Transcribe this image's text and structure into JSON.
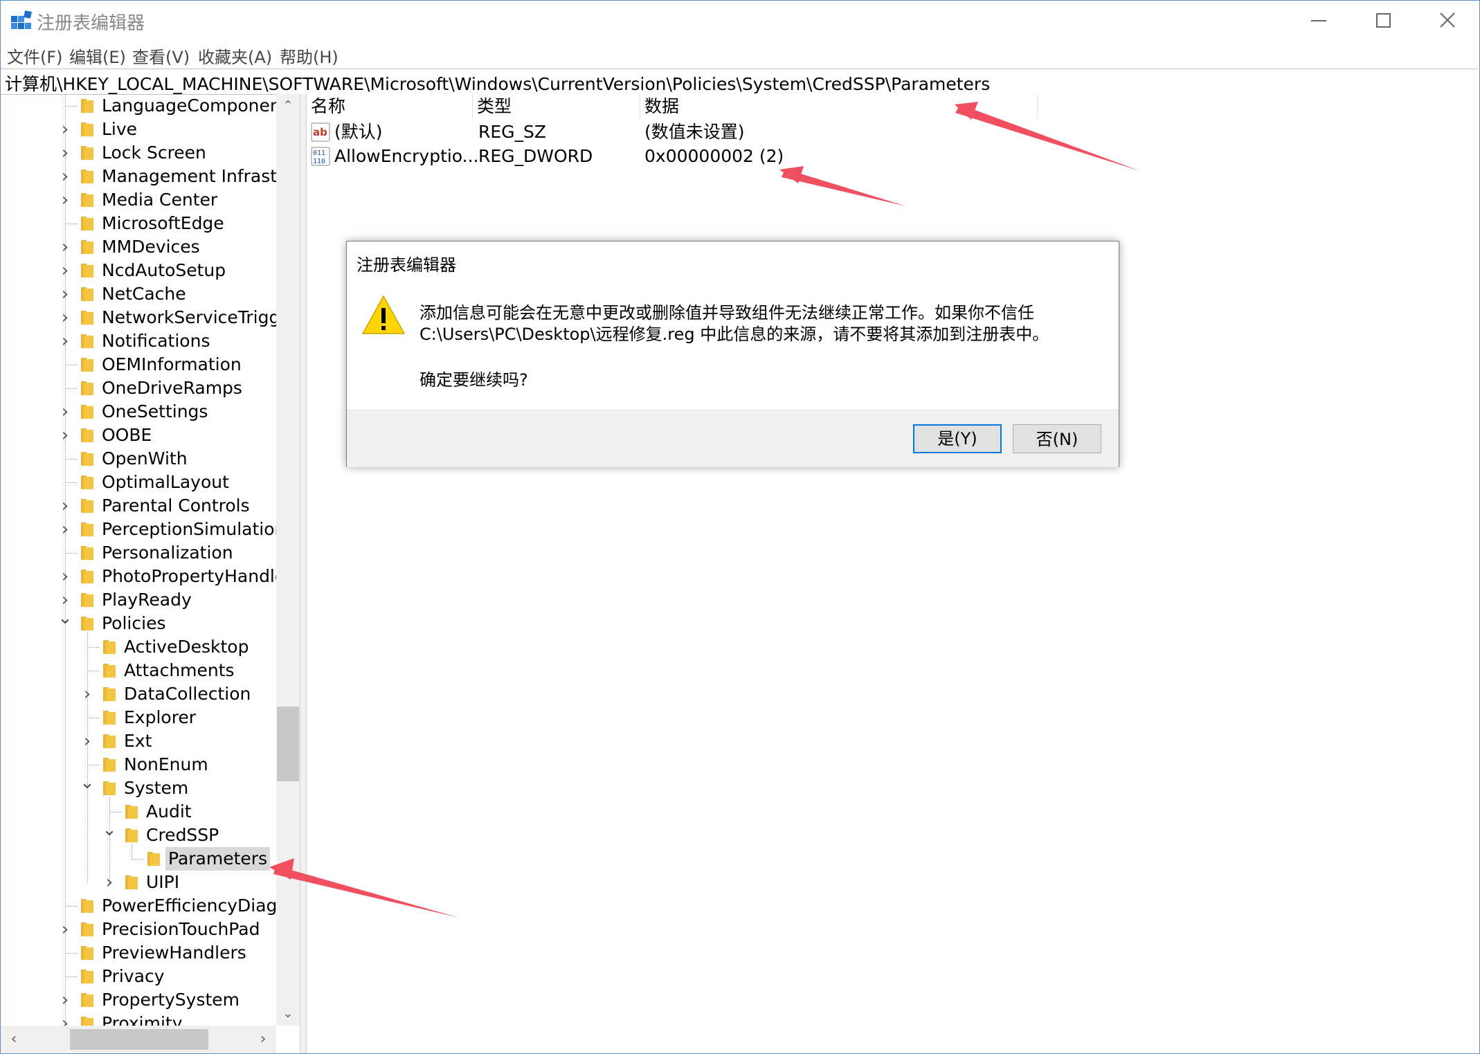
{
  "window": {
    "title": "注册表编辑器"
  },
  "menu": [
    "文件(F)",
    "编辑(E)",
    "查看(V)",
    "收藏夹(A)",
    "帮助(H)"
  ],
  "address": "计算机\\HKEY_LOCAL_MACHINE\\SOFTWARE\\Microsoft\\Windows\\CurrentVersion\\Policies\\System\\CredSSP\\Parameters",
  "tree": [
    {
      "label": "LanguageComponents",
      "depth": 0,
      "exp": "none"
    },
    {
      "label": "Live",
      "depth": 0,
      "exp": "collapsed"
    },
    {
      "label": "Lock Screen",
      "depth": 0,
      "exp": "collapsed"
    },
    {
      "label": "Management Infrastructure",
      "depth": 0,
      "exp": "collapsed"
    },
    {
      "label": "Media Center",
      "depth": 0,
      "exp": "collapsed"
    },
    {
      "label": "MicrosoftEdge",
      "depth": 0,
      "exp": "none"
    },
    {
      "label": "MMDevices",
      "depth": 0,
      "exp": "collapsed"
    },
    {
      "label": "NcdAutoSetup",
      "depth": 0,
      "exp": "collapsed"
    },
    {
      "label": "NetCache",
      "depth": 0,
      "exp": "collapsed"
    },
    {
      "label": "NetworkServiceTriggers",
      "depth": 0,
      "exp": "collapsed"
    },
    {
      "label": "Notifications",
      "depth": 0,
      "exp": "collapsed"
    },
    {
      "label": "OEMInformation",
      "depth": 0,
      "exp": "none"
    },
    {
      "label": "OneDriveRamps",
      "depth": 0,
      "exp": "none"
    },
    {
      "label": "OneSettings",
      "depth": 0,
      "exp": "collapsed"
    },
    {
      "label": "OOBE",
      "depth": 0,
      "exp": "collapsed"
    },
    {
      "label": "OpenWith",
      "depth": 0,
      "exp": "none"
    },
    {
      "label": "OptimalLayout",
      "depth": 0,
      "exp": "none"
    },
    {
      "label": "Parental Controls",
      "depth": 0,
      "exp": "collapsed"
    },
    {
      "label": "PerceptionSimulationExtensions",
      "depth": 0,
      "exp": "collapsed"
    },
    {
      "label": "Personalization",
      "depth": 0,
      "exp": "none"
    },
    {
      "label": "PhotoPropertyHandler",
      "depth": 0,
      "exp": "collapsed"
    },
    {
      "label": "PlayReady",
      "depth": 0,
      "exp": "collapsed"
    },
    {
      "label": "Policies",
      "depth": 0,
      "exp": "expanded"
    },
    {
      "label": "ActiveDesktop",
      "depth": 1,
      "exp": "none"
    },
    {
      "label": "Attachments",
      "depth": 1,
      "exp": "none"
    },
    {
      "label": "DataCollection",
      "depth": 1,
      "exp": "collapsed"
    },
    {
      "label": "Explorer",
      "depth": 1,
      "exp": "none"
    },
    {
      "label": "Ext",
      "depth": 1,
      "exp": "collapsed"
    },
    {
      "label": "NonEnum",
      "depth": 1,
      "exp": "none"
    },
    {
      "label": "System",
      "depth": 1,
      "exp": "expanded"
    },
    {
      "label": "Audit",
      "depth": 2,
      "exp": "none"
    },
    {
      "label": "CredSSP",
      "depth": 2,
      "exp": "expanded"
    },
    {
      "label": "Parameters",
      "depth": 3,
      "exp": "none",
      "selected": true
    },
    {
      "label": "UIPI",
      "depth": 2,
      "exp": "collapsed"
    },
    {
      "label": "PowerEfficiencyDiagnostics",
      "depth": 0,
      "exp": "none"
    },
    {
      "label": "PrecisionTouchPad",
      "depth": 0,
      "exp": "collapsed"
    },
    {
      "label": "PreviewHandlers",
      "depth": 0,
      "exp": "none"
    },
    {
      "label": "Privacy",
      "depth": 0,
      "exp": "none"
    },
    {
      "label": "PropertySystem",
      "depth": 0,
      "exp": "collapsed"
    },
    {
      "label": "Proximity",
      "depth": 0,
      "exp": "collapsed"
    }
  ],
  "columns": {
    "name": "名称",
    "type": "类型",
    "data": "数据"
  },
  "values": [
    {
      "icon": "string-value-icon",
      "name": "(默认)",
      "type": "REG_SZ",
      "data": "(数值未设置)"
    },
    {
      "icon": "binary-value-icon",
      "name": "AllowEncryptio...",
      "type": "REG_DWORD",
      "data": "0x00000002 (2)"
    }
  ],
  "dialog": {
    "title": "注册表编辑器",
    "icon": "warning-icon",
    "line1": "添加信息可能会在无意中更改或删除值并导致组件无法继续正常工作。如果你不信任",
    "line2": "C:\\Users\\PC\\Desktop\\远程修复.reg 中此信息的来源，请不要将其添加到注册表中。",
    "question": "确定要继续吗?",
    "yes": "是(Y)",
    "no": "否(N)"
  },
  "colors": {
    "annotation_arrow": "#ef4f5f",
    "folder": "#f5c542",
    "default_button_border": "#0078d7"
  }
}
